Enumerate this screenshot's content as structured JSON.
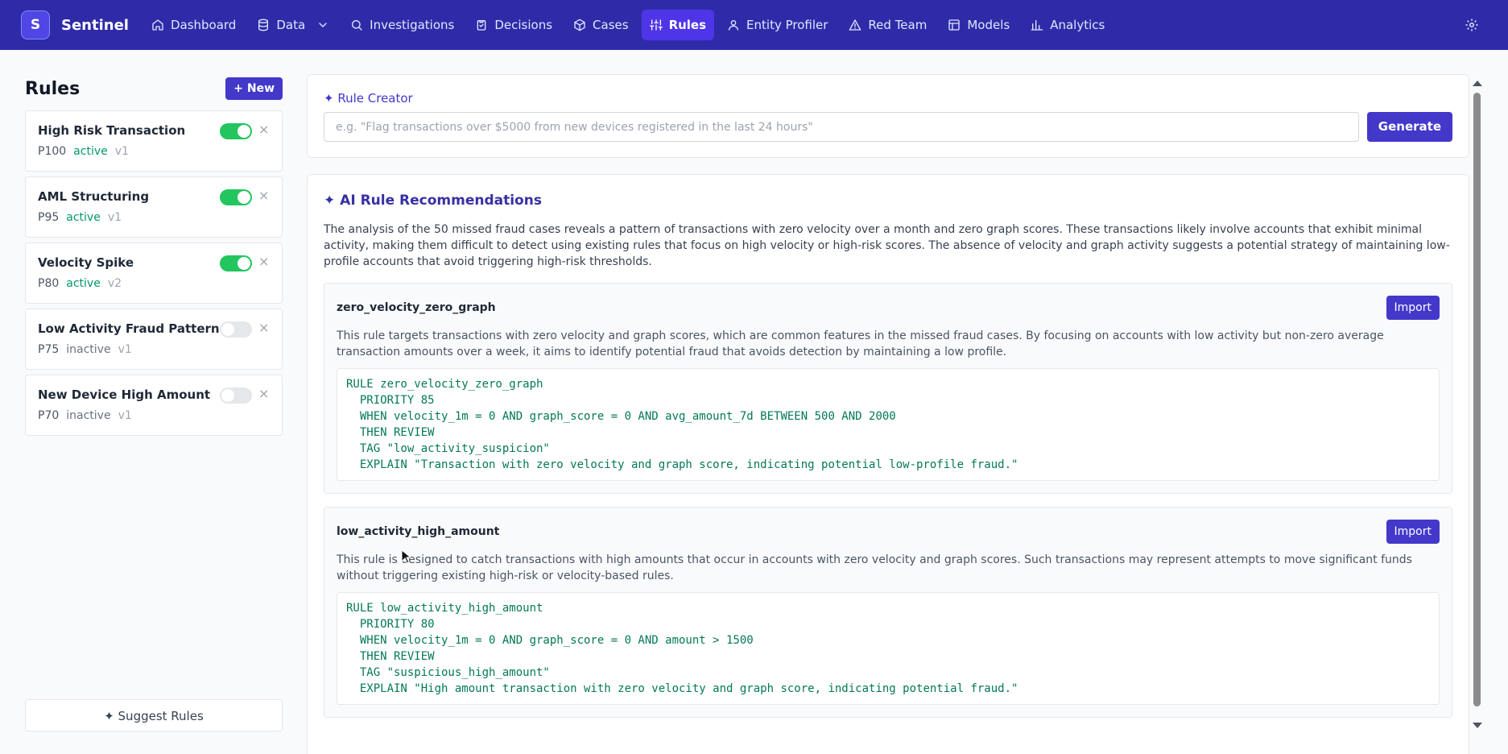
{
  "app": {
    "logo_letter": "S",
    "name": "Sentinel"
  },
  "nav": [
    {
      "label": "Dashboard",
      "icon": "home-icon",
      "active": false
    },
    {
      "label": "Data",
      "icon": "database-icon",
      "active": false,
      "dropdown": true
    },
    {
      "label": "Investigations",
      "icon": "search-icon",
      "active": false
    },
    {
      "label": "Decisions",
      "icon": "clipboard-icon",
      "active": false
    },
    {
      "label": "Cases",
      "icon": "box-icon",
      "active": false
    },
    {
      "label": "Rules",
      "icon": "sliders-icon",
      "active": true
    },
    {
      "label": "Entity Profiler",
      "icon": "user-icon",
      "active": false
    },
    {
      "label": "Red Team",
      "icon": "warning-icon",
      "active": false
    },
    {
      "label": "Models",
      "icon": "layout-icon",
      "active": false
    },
    {
      "label": "Analytics",
      "icon": "bar-chart-icon",
      "active": false
    }
  ],
  "sidebar": {
    "title": "Rules",
    "new_label": "+ New",
    "rules": [
      {
        "name": "High Risk Transaction",
        "priority": "P100",
        "status": "active",
        "version": "v1",
        "enabled": true
      },
      {
        "name": "AML Structuring",
        "priority": "P95",
        "status": "active",
        "version": "v1",
        "enabled": true
      },
      {
        "name": "Velocity Spike",
        "priority": "P80",
        "status": "active",
        "version": "v2",
        "enabled": true
      },
      {
        "name": "Low Activity Fraud Pattern",
        "priority": "P75",
        "status": "inactive",
        "version": "v1",
        "enabled": false
      },
      {
        "name": "New Device High Amount",
        "priority": "P70",
        "status": "inactive",
        "version": "v1",
        "enabled": false
      }
    ],
    "close_symbol": "×",
    "suggest_label": "✦ Suggest Rules"
  },
  "creator": {
    "label": "✦ Rule Creator",
    "placeholder": "e.g. \"Flag transactions over $5000 from new devices registered in the last 24 hours\"",
    "generate_label": "Generate"
  },
  "recommendations": {
    "title": "✦ AI Rule Recommendations",
    "summary": "The analysis of the 50 missed fraud cases reveals a pattern of transactions with zero velocity over a month and zero graph scores. These transactions likely involve accounts that exhibit minimal activity, making them difficult to detect using existing rules that focus on high velocity or high-risk scores. The absence of velocity and graph activity suggests a potential strategy of maintaining low-profile accounts that avoid triggering high-risk thresholds.",
    "import_label": "Import",
    "items": [
      {
        "name": "zero_velocity_zero_graph",
        "description": "This rule targets transactions with zero velocity and graph scores, which are common features in the missed fraud cases. By focusing on accounts with low activity but non-zero average transaction amounts over a week, it aims to identify potential fraud that avoids detection by maintaining a low profile.",
        "code": "RULE zero_velocity_zero_graph\n  PRIORITY 85\n  WHEN velocity_1m = 0 AND graph_score = 0 AND avg_amount_7d BETWEEN 500 AND 2000\n  THEN REVIEW\n  TAG \"low_activity_suspicion\"\n  EXPLAIN \"Transaction with zero velocity and graph score, indicating potential low-profile fraud.\""
      },
      {
        "name": "low_activity_high_amount",
        "description": "This rule is designed to catch transactions with high amounts that occur in accounts with zero velocity and graph scores. Such transactions may represent attempts to move significant funds without triggering existing high-risk or velocity-based rules.",
        "code": "RULE low_activity_high_amount\n  PRIORITY 80\n  WHEN velocity_1m = 0 AND graph_score = 0 AND amount > 1500\n  THEN REVIEW\n  TAG \"suspicious_high_amount\"\n  EXPLAIN \"High amount transaction with zero velocity and graph score, indicating potential fraud.\""
      }
    ]
  },
  "colors": {
    "nav_bg": "#2f2ba8",
    "accent": "#4338ca",
    "toggle_on": "#22c55e",
    "code_text": "#047857"
  }
}
